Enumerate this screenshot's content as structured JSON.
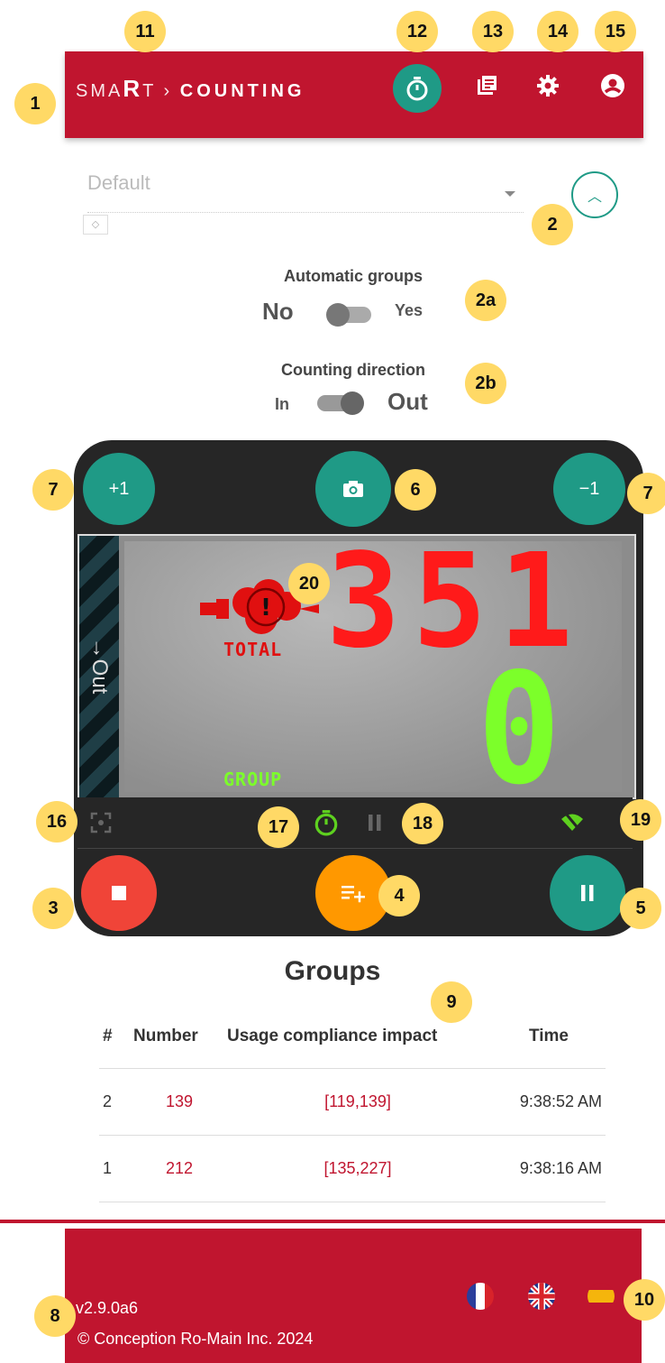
{
  "header": {
    "logo_light": "SMA",
    "logo_r": "R",
    "logo_t": "T",
    "logo_sep": "›",
    "logo_bold": "COUNTING",
    "icons": [
      "timer-icon",
      "report-icon",
      "settings-icon",
      "account-icon"
    ]
  },
  "selector": {
    "value": "Default"
  },
  "automatic_groups": {
    "title": "Automatic groups",
    "no_label": "No",
    "yes_label": "Yes",
    "state": "No"
  },
  "counting_direction": {
    "title": "Counting direction",
    "in_label": "In",
    "out_label": "Out",
    "state": "Out"
  },
  "controls": {
    "plus_label": "+1",
    "minus_label": "−1",
    "camera_icon": "camera-icon",
    "stop_icon": "stop-icon",
    "add_group_icon": "playlist-add-icon",
    "pause_icon": "pause-icon"
  },
  "display": {
    "direction_label": "→Out",
    "total_value": "351",
    "total_label": "TOTAL",
    "group_value": "0",
    "group_label": "GROUP",
    "alert_symbol": "!"
  },
  "colors": {
    "brand": "#c0152f",
    "accent": "#1f9a86",
    "stop": "#f04438",
    "add_group": "#ff9800",
    "total_digits": "#ff1a1a",
    "group_digits": "#7cff2a"
  },
  "groups": {
    "title": "Groups",
    "headers": [
      "#",
      "Number",
      "Usage compliance impact",
      "Time"
    ],
    "rows": [
      {
        "id": "2",
        "number": "139",
        "impact": "[119,139]",
        "time": "9:38:52 AM"
      },
      {
        "id": "1",
        "number": "212",
        "impact": "[135,227]",
        "time": "9:38:16 AM"
      }
    ]
  },
  "footer": {
    "version": "v2.9.0a6",
    "copyright": "© Conception Ro-Main Inc. 2024",
    "languages": [
      "French",
      "English",
      "Spanish"
    ]
  },
  "callouts": {
    "c1": "1",
    "c2": "2",
    "c2a": "2a",
    "c2b": "2b",
    "c3": "3",
    "c4": "4",
    "c5": "5",
    "c6": "6",
    "c7a": "7",
    "c7b": "7",
    "c8": "8",
    "c9": "9",
    "c10": "10",
    "c11": "11",
    "c12": "12",
    "c13": "13",
    "c14": "14",
    "c15": "15",
    "c16": "16",
    "c17": "17",
    "c18": "18",
    "c19": "19",
    "c20": "20"
  }
}
